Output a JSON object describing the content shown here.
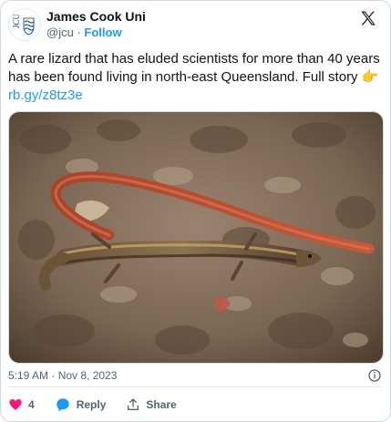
{
  "account": {
    "display_name": "James Cook Uni",
    "handle": "@jcu",
    "separator": "·",
    "follow_label": "Follow",
    "avatar_text": "JCU"
  },
  "tweet": {
    "text": "A rare lizard that has eluded scientists for more than 40 years has been found living in north-east Queensland. Full story",
    "emoji": "👉",
    "link": "rb.gy/z8tz3e",
    "timestamp": "5:19 AM · Nov 8, 2023"
  },
  "actions": {
    "likes": "4",
    "reply_label": "Reply",
    "share_label": "Share"
  },
  "icons": {
    "logo": "x-logo-icon",
    "info": "info-icon",
    "like": "heart-icon",
    "reply": "reply-icon",
    "share": "share-icon"
  },
  "colors": {
    "accent": "#1d9bf0",
    "like": "#f91880",
    "text": "#0f1419",
    "muted": "#536471"
  }
}
